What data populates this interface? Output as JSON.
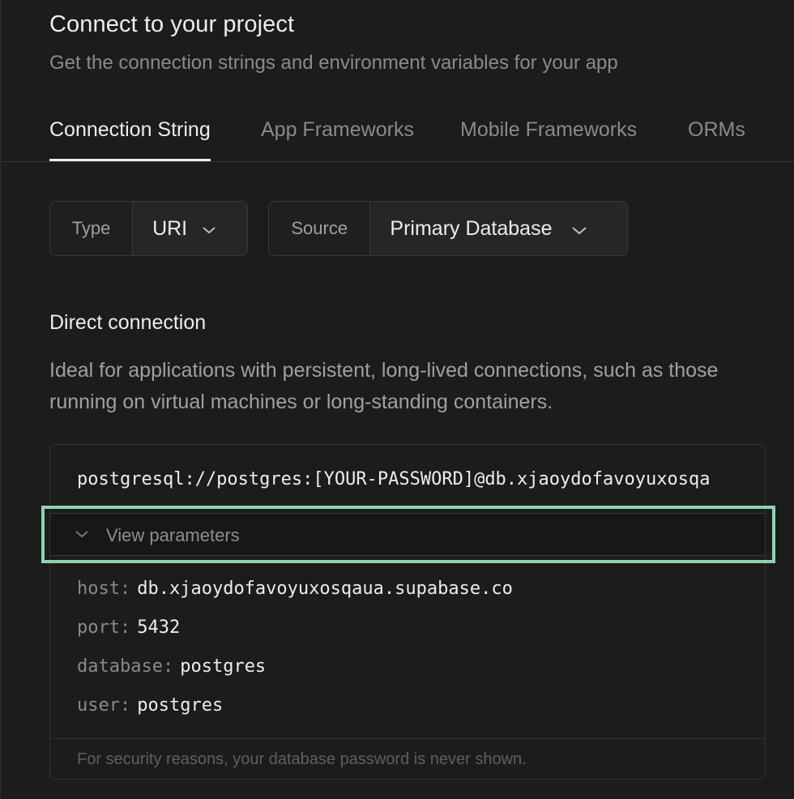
{
  "header": {
    "title": "Connect to your project",
    "subtitle": "Get the connection strings and environment variables for your app"
  },
  "tabs": [
    {
      "label": "Connection String",
      "active": true
    },
    {
      "label": "App Frameworks",
      "active": false
    },
    {
      "label": "Mobile Frameworks",
      "active": false
    },
    {
      "label": "ORMs",
      "active": false
    }
  ],
  "selectors": {
    "type": {
      "label": "Type",
      "value": "URI"
    },
    "source": {
      "label": "Source",
      "value": "Primary Database"
    }
  },
  "direct": {
    "title": "Direct connection",
    "description": "Ideal for applications with persistent, long-lived connections, such as those running on virtual machines or long-standing containers.",
    "connection_string": "postgresql://postgres:[YOUR-PASSWORD]@db.xjaoydofavoyuxosqa",
    "view_params_label": "View parameters",
    "params": [
      {
        "key": "host:",
        "value": "db.xjaoydofavoyuxosqaua.supabase.co"
      },
      {
        "key": "port:",
        "value": "5432"
      },
      {
        "key": "database:",
        "value": "postgres"
      },
      {
        "key": "user:",
        "value": "postgres"
      }
    ],
    "footer_note": "For security reasons, your database password is never shown."
  },
  "colors": {
    "background": "#1c1c1c",
    "highlight": "#8fd3ad",
    "muted_text": "#8a8a8a"
  },
  "icons": {
    "dropdown": "chevron-down-icon"
  }
}
